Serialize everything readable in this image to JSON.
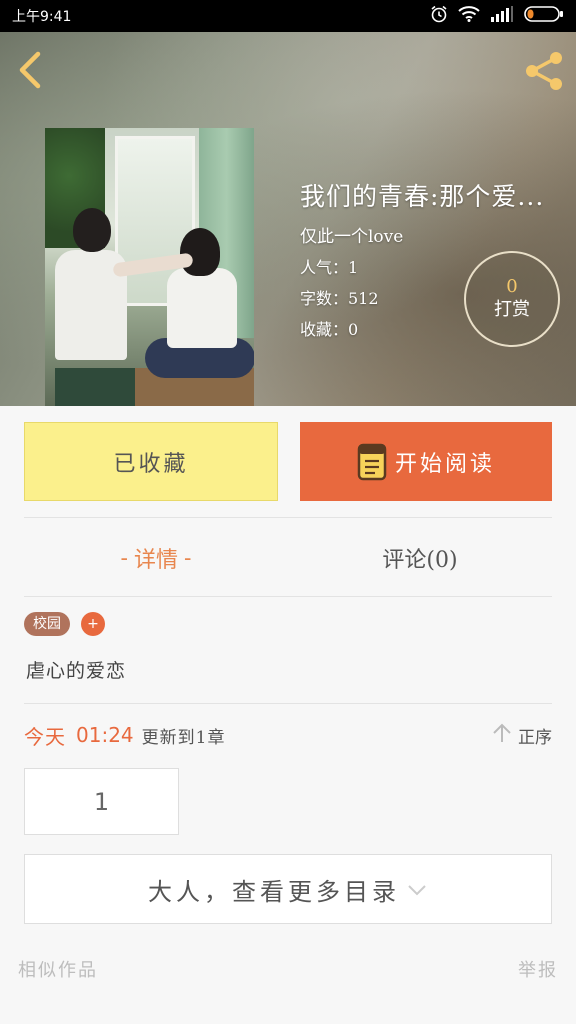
{
  "status_bar": {
    "time": "上午9:41",
    "icons": [
      "alarm-icon",
      "wifi-icon",
      "signal-icon",
      "battery-icon"
    ]
  },
  "header": {
    "back_icon": "chevron-left-icon",
    "share_icon": "share-icon",
    "accent_color": "#f5c86b"
  },
  "book": {
    "title": "我们的青春:那个爱...",
    "author": "仅此一个love",
    "popularity_label": "人气：1",
    "word_count_label": "字数：512",
    "favorites_label": "收藏：0"
  },
  "reward": {
    "count": "0",
    "label": "打赏"
  },
  "actions": {
    "collected_label": "已收藏",
    "collected_color": "#fbf08c",
    "read_label": "开始阅读",
    "read_color": "#e8693e",
    "read_icon": "book-icon"
  },
  "tabs": {
    "details_label": "详情",
    "details_prefix": "-",
    "details_suffix": "-",
    "comments_label": "评论(0)"
  },
  "tag": {
    "label": "校园",
    "add_label": "+"
  },
  "description": "虐心的爱恋",
  "update": {
    "today": "今天",
    "time": "01:24",
    "text": "更新到1章",
    "sort_label": "正序",
    "sort_icon": "arrow-up-icon"
  },
  "chapter": {
    "number": "1"
  },
  "more_catalog": {
    "label": "大人，查看更多目录",
    "icon": "chevron-down-icon"
  },
  "footer": {
    "similar_label": "相似作品",
    "report_label": "举报"
  }
}
